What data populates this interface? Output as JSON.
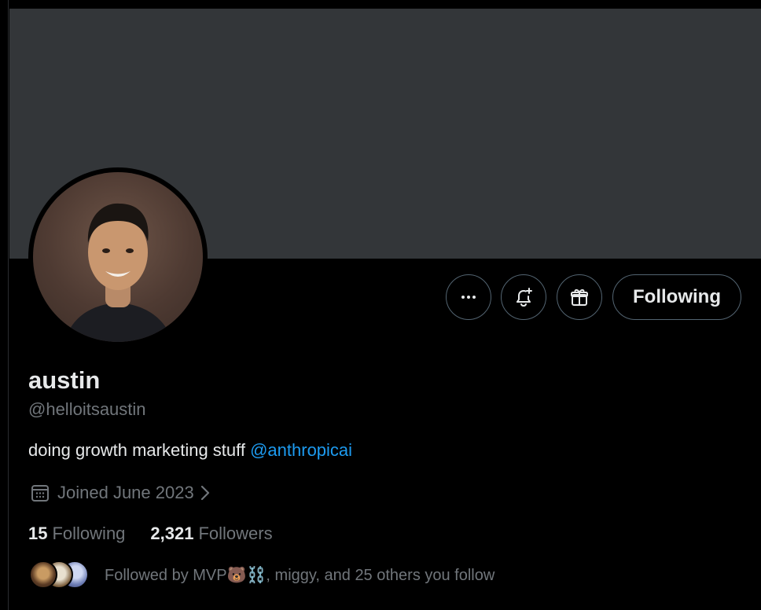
{
  "profile": {
    "name": "austin",
    "handle": "@helloitsaustin",
    "bio_text": "doing growth marketing stuff ",
    "bio_mention": "@anthropicai",
    "joined": "Joined June 2023",
    "following_count": "15",
    "following_label": "Following",
    "followers_count": "2,321",
    "followers_label": "Followers",
    "followed_by": "Followed by MVP🐻⛓️, miggy, and 25 others you follow"
  },
  "actions": {
    "more_icon": "more-icon",
    "notify_icon": "bell-plus-icon",
    "gift_icon": "gift-icon",
    "follow_label": "Following"
  },
  "colors": {
    "background": "#000000",
    "banner": "#333639",
    "accent": "#1d9bf0",
    "secondary_text": "#71767b",
    "primary_text": "#e7e9ea",
    "button_border": "#536471"
  }
}
